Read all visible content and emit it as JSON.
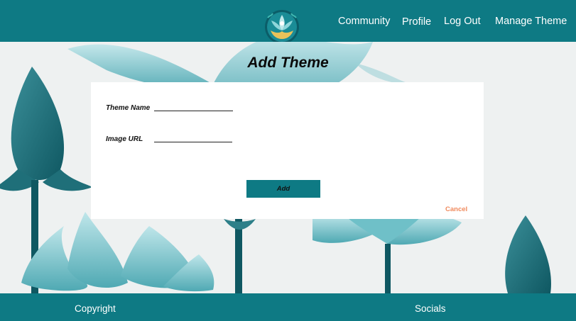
{
  "header": {
    "logo_icon": "lotus-logo-icon",
    "nav": [
      {
        "label": "Community"
      },
      {
        "label": "Profile"
      },
      {
        "label": "Log Out"
      },
      {
        "label": "Manage Theme"
      }
    ]
  },
  "page": {
    "title": "Add Theme"
  },
  "form": {
    "theme_name_label": "Theme Name",
    "theme_name_value": "",
    "image_url_label": "Image URL",
    "image_url_value": "",
    "add_label": "Add",
    "cancel_label": "Cancel"
  },
  "footer": {
    "copyright": "Copyright",
    "socials": "Socials"
  },
  "colors": {
    "brand_teal": "#0e7a84",
    "cancel_orange": "#f08a5d",
    "background_image": "teal-lotus-flowers"
  }
}
